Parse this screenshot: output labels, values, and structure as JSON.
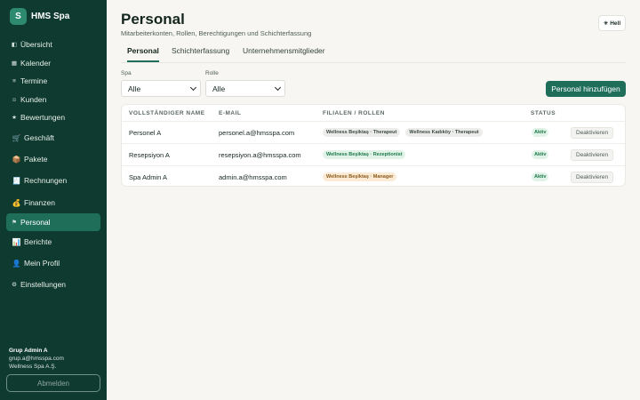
{
  "sidebar": {
    "brand_initial": "S",
    "brand_name": "HMS Spa",
    "items": [
      {
        "label": "Übersicht",
        "icon": "◧"
      },
      {
        "label": "Kalender",
        "icon": "▦"
      },
      {
        "label": "Termine",
        "icon": "≡"
      },
      {
        "label": "Kunden",
        "icon": "☺"
      },
      {
        "label": "Bewertungen",
        "icon": "★"
      },
      {
        "label": "Geschäft",
        "icon": "🛒"
      },
      {
        "label": "Pakete",
        "icon": "📦"
      },
      {
        "label": "Rechnungen",
        "icon": "🧾"
      },
      {
        "label": "Finanzen",
        "icon": "💰"
      },
      {
        "label": "Personal",
        "icon": "⚑"
      },
      {
        "label": "Berichte",
        "icon": "📊"
      },
      {
        "label": "Mein Profil",
        "icon": "👤"
      },
      {
        "label": "Einstellungen",
        "icon": "⚙"
      }
    ],
    "active_item": "Personal",
    "user": {
      "name": "Grup Admin A",
      "email": "grup.a@hmsspa.com",
      "company": "Wellness Spa A.Ş."
    },
    "logout_label": "Abmelden"
  },
  "header": {
    "title": "Personal",
    "subtitle": "Mitarbeiterkonten, Rollen, Berechtigungen und Schichterfassung",
    "theme_label": "Hell"
  },
  "tabs": [
    {
      "label": "Personal",
      "active": true
    },
    {
      "label": "Schichterfassung",
      "active": false
    },
    {
      "label": "Unternehmensmitglieder",
      "active": false
    }
  ],
  "filters": {
    "spa_label": "Spa",
    "spa_value": "Alle",
    "role_label": "Rolle",
    "role_value": "Alle"
  },
  "add_button_label": "Personal hinzufügen",
  "table": {
    "columns": [
      "VOLLSTÄNDIGER NAME",
      "E-MAIL",
      "FILIALEN / ROLLEN",
      "STATUS"
    ],
    "rows": [
      {
        "name": "Personel A",
        "email": "personel.a@hmsspa.com",
        "roles": [
          {
            "label": "Wellness Beşiktaş · Therapeut",
            "color": "grey"
          },
          {
            "label": "Wellness Kadıköy · Therapeut",
            "color": "grey"
          }
        ],
        "status": "Aktiv",
        "action": "Deaktivieren"
      },
      {
        "name": "Resepsiyon A",
        "email": "resepsiyon.a@hmsspa.com",
        "roles": [
          {
            "label": "Wellness Beşiktaş · Rezeptionist",
            "color": "green"
          }
        ],
        "status": "Aktiv",
        "action": "Deaktivieren"
      },
      {
        "name": "Spa Admin A",
        "email": "admin.a@hmsspa.com",
        "roles": [
          {
            "label": "Wellness Beşiktaş · Manager",
            "color": "orange"
          }
        ],
        "status": "Aktiv",
        "action": "Deaktivieren"
      }
    ]
  },
  "colors": {
    "sidebar_bg": "#0f3a2f",
    "accent": "#1f6e5a",
    "page_bg": "#f7f6f2"
  }
}
